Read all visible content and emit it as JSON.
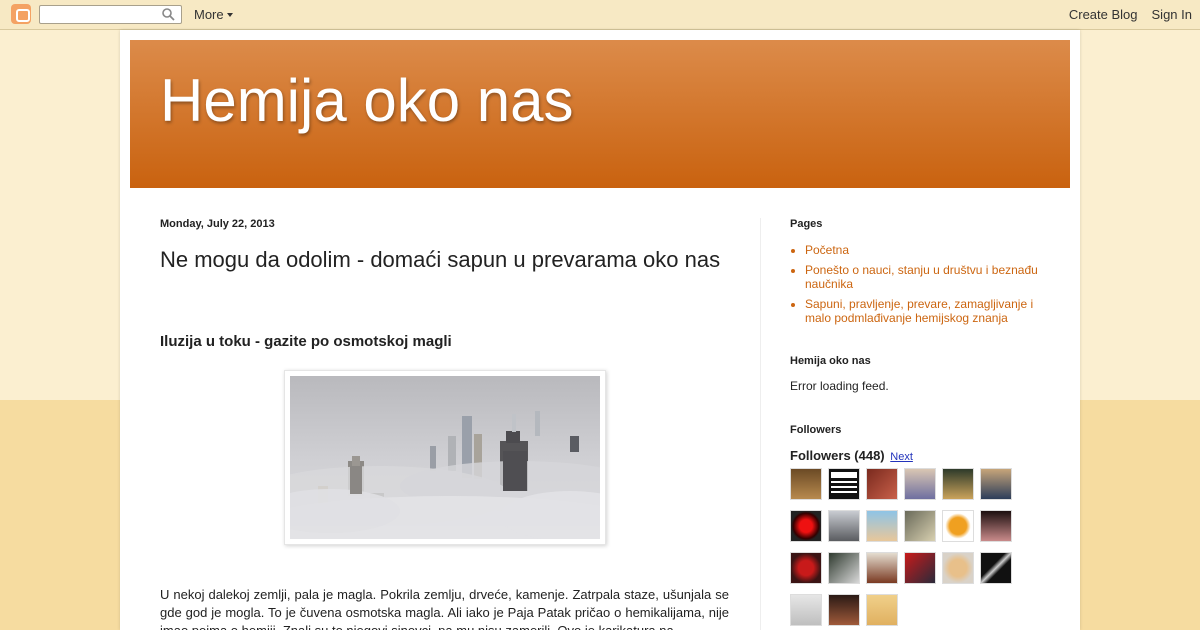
{
  "navbar": {
    "search_placeholder": "",
    "more_label": "More",
    "create_blog_label": "Create Blog",
    "sign_in_label": "Sign In"
  },
  "header": {
    "blog_title": "Hemija oko nas"
  },
  "post": {
    "date": "Monday, July 22, 2013",
    "title": "Ne mogu da odolim - domaći sapun u prevarama oko nas",
    "subheading": "Iluzija u toku - gazite po osmotskoj magli",
    "body": "U nekoj dalekoj zemlji, pala je magla. Pokrila zemlju, drveće, kamenje. Zatrpala staze, ušunjala se gde god je mogla. To je čuvena osmotska magla. Ali iako je Paja Patak pričao o hemikalijama, nije imao pojma o hemiji. Znali su to njegovi sinovci, pa mu nisu zamerili. Ovo je karikatura na"
  },
  "sidebar": {
    "pages_title": "Pages",
    "pages": [
      "Početna",
      "Ponešto o nauci, stanju u društvu i beznađu naučnika",
      "Sapuni, pravljenje, prevare, zamagljivanje i malo podmlađivanje hemijskog znanja"
    ],
    "feed_title": "Hemija oko nas",
    "feed_text": "Error loading feed.",
    "followers_title": "Followers",
    "followers_label": "Followers (448)",
    "followers_next": "Next"
  },
  "colors": {
    "accent": "#cc6611",
    "header_top": "#dc8b4a",
    "header_bottom": "#c9620f",
    "page_bg_top": "#fbefd0",
    "page_bg_bottom": "#f6dca0"
  }
}
